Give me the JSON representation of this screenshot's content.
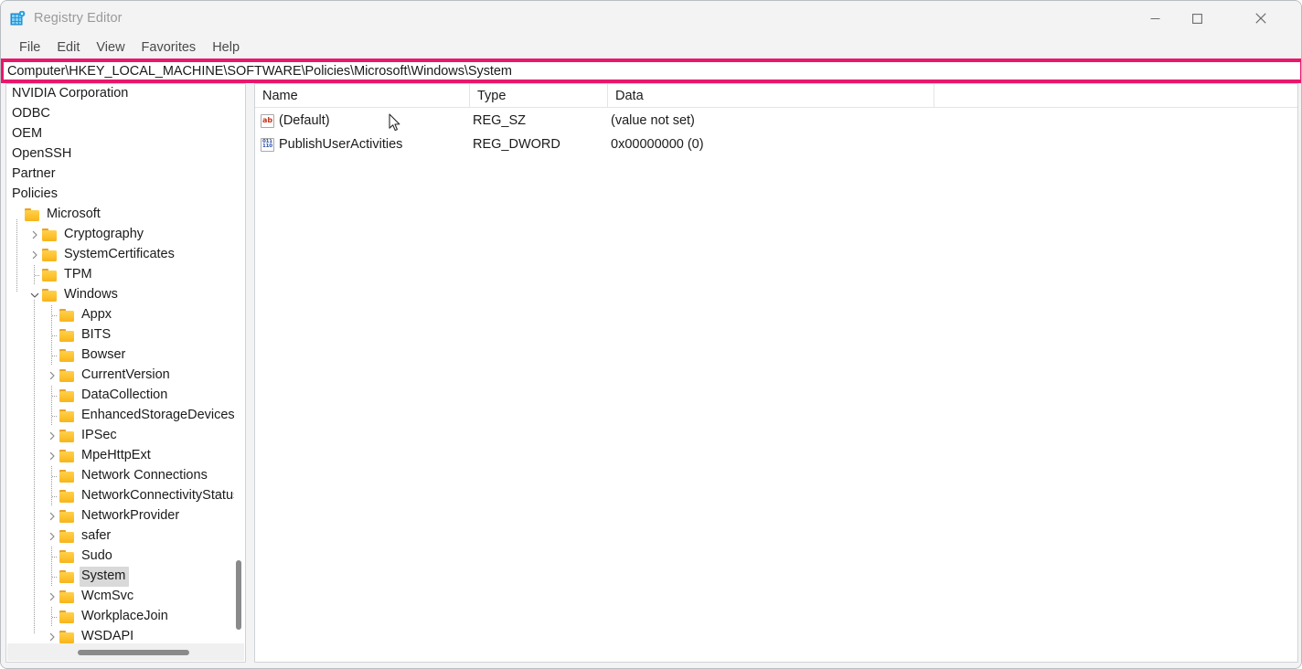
{
  "window": {
    "title": "Registry Editor",
    "icon": "registry-editor-icon",
    "controls": {
      "minimize": "—",
      "maximize": "□",
      "close": "✕"
    }
  },
  "menubar": {
    "items": [
      {
        "label": "File"
      },
      {
        "label": "Edit"
      },
      {
        "label": "View"
      },
      {
        "label": "Favorites"
      },
      {
        "label": "Help"
      }
    ]
  },
  "address_bar": {
    "value": "Computer\\HKEY_LOCAL_MACHINE\\SOFTWARE\\Policies\\Microsoft\\Windows\\System",
    "highlight_color": "#e8176c"
  },
  "tree": {
    "items": [
      {
        "label": "NVIDIA Corporation",
        "depth": 0,
        "folder": false,
        "chevron": "none",
        "selected": false
      },
      {
        "label": "ODBC",
        "depth": 0,
        "folder": false,
        "chevron": "none",
        "selected": false
      },
      {
        "label": "OEM",
        "depth": 0,
        "folder": false,
        "chevron": "none",
        "selected": false
      },
      {
        "label": "OpenSSH",
        "depth": 0,
        "folder": false,
        "chevron": "none",
        "selected": false
      },
      {
        "label": "Partner",
        "depth": 0,
        "folder": false,
        "chevron": "none",
        "selected": false
      },
      {
        "label": "Policies",
        "depth": 0,
        "folder": false,
        "chevron": "none",
        "selected": false
      },
      {
        "label": "Microsoft",
        "depth": 0,
        "folder": true,
        "chevron": "none",
        "selected": false
      },
      {
        "label": "Cryptography",
        "depth": 1,
        "folder": true,
        "chevron": "collapsed",
        "selected": false
      },
      {
        "label": "SystemCertificates",
        "depth": 1,
        "folder": true,
        "chevron": "collapsed",
        "selected": false
      },
      {
        "label": "TPM",
        "depth": 1,
        "folder": true,
        "chevron": "none",
        "selected": false
      },
      {
        "label": "Windows",
        "depth": 1,
        "folder": true,
        "chevron": "expanded",
        "selected": false
      },
      {
        "label": "Appx",
        "depth": 2,
        "folder": true,
        "chevron": "none",
        "selected": false
      },
      {
        "label": "BITS",
        "depth": 2,
        "folder": true,
        "chevron": "none",
        "selected": false
      },
      {
        "label": "Bowser",
        "depth": 2,
        "folder": true,
        "chevron": "none",
        "selected": false
      },
      {
        "label": "CurrentVersion",
        "depth": 2,
        "folder": true,
        "chevron": "collapsed",
        "selected": false
      },
      {
        "label": "DataCollection",
        "depth": 2,
        "folder": true,
        "chevron": "none",
        "selected": false
      },
      {
        "label": "EnhancedStorageDevices",
        "depth": 2,
        "folder": true,
        "chevron": "none",
        "selected": false
      },
      {
        "label": "IPSec",
        "depth": 2,
        "folder": true,
        "chevron": "collapsed",
        "selected": false
      },
      {
        "label": "MpeHttpExt",
        "depth": 2,
        "folder": true,
        "chevron": "collapsed",
        "selected": false
      },
      {
        "label": "Network Connections",
        "depth": 2,
        "folder": true,
        "chevron": "none",
        "selected": false
      },
      {
        "label": "NetworkConnectivityStatusIndicator",
        "depth": 2,
        "folder": true,
        "chevron": "none",
        "selected": false
      },
      {
        "label": "NetworkProvider",
        "depth": 2,
        "folder": true,
        "chevron": "collapsed",
        "selected": false
      },
      {
        "label": "safer",
        "depth": 2,
        "folder": true,
        "chevron": "collapsed",
        "selected": false
      },
      {
        "label": "Sudo",
        "depth": 2,
        "folder": true,
        "chevron": "none",
        "selected": false
      },
      {
        "label": "System",
        "depth": 2,
        "folder": true,
        "chevron": "none",
        "selected": true
      },
      {
        "label": "WcmSvc",
        "depth": 2,
        "folder": true,
        "chevron": "collapsed",
        "selected": false
      },
      {
        "label": "WorkplaceJoin",
        "depth": 2,
        "folder": true,
        "chevron": "none",
        "selected": false
      },
      {
        "label": "WSDAPI",
        "depth": 2,
        "folder": true,
        "chevron": "collapsed",
        "selected": false
      }
    ]
  },
  "values_list": {
    "columns": [
      "Name",
      "Type",
      "Data"
    ],
    "rows": [
      {
        "icon": "reg-sz-icon",
        "icon_glyph": "ab",
        "name": "(Default)",
        "type": "REG_SZ",
        "data": "(value not set)"
      },
      {
        "icon": "reg-dword-icon",
        "icon_glyph": "011\n110",
        "name": "PublishUserActivities",
        "type": "REG_DWORD",
        "data": "0x00000000 (0)"
      }
    ]
  }
}
